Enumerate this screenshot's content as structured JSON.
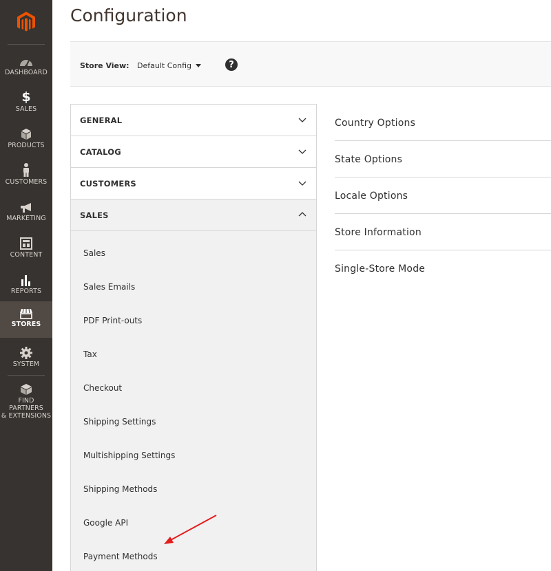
{
  "colors": {
    "sidebar_bg": "#373330",
    "sidebar_active": "#514943",
    "logo_orange": "#eb5202",
    "annotation_red": "#e41c1c"
  },
  "sidebar": {
    "items": [
      {
        "label": "Dashboard",
        "icon": "dashboard-icon"
      },
      {
        "label": "Sales",
        "icon": "dollar-icon"
      },
      {
        "label": "Products",
        "icon": "cube-icon"
      },
      {
        "label": "Customers",
        "icon": "person-icon"
      },
      {
        "label": "Marketing",
        "icon": "megaphone-icon"
      },
      {
        "label": "Content",
        "icon": "layout-icon"
      },
      {
        "label": "Reports",
        "icon": "bar-chart-icon"
      },
      {
        "label": "Stores",
        "icon": "storefront-icon",
        "active": true
      },
      {
        "label": "System",
        "icon": "gear-icon"
      },
      {
        "label": "Find Partners\n& Extensions",
        "line1": "Find Partners",
        "line2": "& Extensions",
        "icon": "box-icon"
      }
    ]
  },
  "header": {
    "title": "Configuration"
  },
  "store_view": {
    "label": "Store View:",
    "value": "Default Config",
    "help": "?"
  },
  "tabs": [
    {
      "title": "GENERAL",
      "open": false
    },
    {
      "title": "CATALOG",
      "open": false
    },
    {
      "title": "CUSTOMERS",
      "open": false
    },
    {
      "title": "SALES",
      "open": true
    }
  ],
  "sales_items": [
    "Sales",
    "Sales Emails",
    "PDF Print-outs",
    "Tax",
    "Checkout",
    "Shipping Settings",
    "Multishipping Settings",
    "Shipping Methods",
    "Google API",
    "Payment Methods"
  ],
  "sections": [
    "Country Options",
    "State Options",
    "Locale Options",
    "Store Information",
    "Single-Store Mode"
  ]
}
